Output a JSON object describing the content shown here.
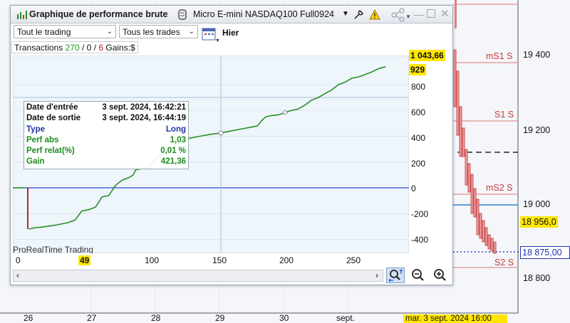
{
  "window": {
    "title": "Graphique de performance brute",
    "instrument": "Micro E-mini NASDAQ100 Full0924"
  },
  "toolbar": {
    "filter1": "Tout le trading",
    "filter2": "Tous les trades",
    "period": "Hier"
  },
  "summary": {
    "prefix": "Transactions ",
    "total": "270",
    "sep1": " / ",
    "zero": "0",
    "sep2": " / ",
    "six": "6",
    "gains_label": " Gains:$"
  },
  "perf_chart": {
    "y_ticks": [
      "800",
      "600",
      "400",
      "200",
      "0",
      "-200",
      "-400"
    ],
    "x_ticks": [
      "0",
      "49",
      "100",
      "150",
      "200",
      "250"
    ],
    "last_value_label": "1 043,66",
    "cursor_value_label": "929",
    "watermark": "ProRealTime Trading"
  },
  "chart_data": {
    "type": "line",
    "title": "",
    "xlabel": "",
    "ylabel": "",
    "xlim": [
      0,
      290
    ],
    "ylim": [
      -480,
      1060
    ],
    "series": [
      {
        "color": "#2a8f2a",
        "x": [
          0,
          4,
          7,
          10,
          11,
          15,
          20,
          30,
          40,
          45,
          50,
          55,
          60,
          62,
          65,
          70,
          75,
          80,
          85,
          88,
          90,
          95,
          100,
          105,
          110,
          115,
          118,
          120,
          125,
          130,
          135,
          140,
          145,
          150,
          155,
          160,
          165,
          170,
          175,
          180,
          183,
          186,
          190,
          195,
          200,
          205,
          210,
          215,
          220,
          225,
          230,
          235,
          240,
          245,
          250,
          255,
          260,
          265,
          270,
          275
        ],
        "y": [
          0,
          5,
          10,
          15,
          -320,
          -310,
          -305,
          -290,
          -270,
          -250,
          -180,
          -170,
          -150,
          -120,
          -70,
          -60,
          20,
          60,
          80,
          100,
          140,
          150,
          160,
          230,
          260,
          280,
          300,
          350,
          370,
          385,
          395,
          405,
          415,
          421,
          430,
          440,
          450,
          460,
          470,
          480,
          520,
          550,
          560,
          565,
          580,
          600,
          610,
          640,
          680,
          700,
          730,
          760,
          800,
          820,
          850,
          860,
          880,
          900,
          925,
          940
        ]
      }
    ],
    "tooltip": {
      "entry_label": "Date d'entrée",
      "entry_value": "3 sept. 2024, 16:42:21",
      "exit_label": "Date de sortie",
      "exit_value": "3 sept. 2024, 16:44:19",
      "type_label": "Type",
      "type_value": "Long",
      "abs_label": "Perf abs",
      "abs_value": "1,03",
      "rel_label": "Perf relat(%)",
      "rel_value": "0,01 %",
      "gain_label": "Gain",
      "gain_value": "421,36"
    }
  },
  "background_chart": {
    "pivot_labels": [
      "mS1 S",
      "S1 S",
      "mS2 S",
      "S2 S"
    ],
    "price_ticks": [
      "19 400",
      "19 200",
      "19 000",
      "18 800"
    ],
    "price_marker_1": "18 956,0",
    "price_marker_2": "18 875,00",
    "date_ticks": [
      "26",
      "27",
      "28",
      "29",
      "30",
      "sept."
    ],
    "current_date": "mar. 3 sept. 2024 16:00"
  },
  "colors": {
    "equity_line": "#2a8f2a",
    "zero_line": "#3344cc",
    "pivot_line": "#e09090",
    "label_bg": "#ffe600"
  }
}
